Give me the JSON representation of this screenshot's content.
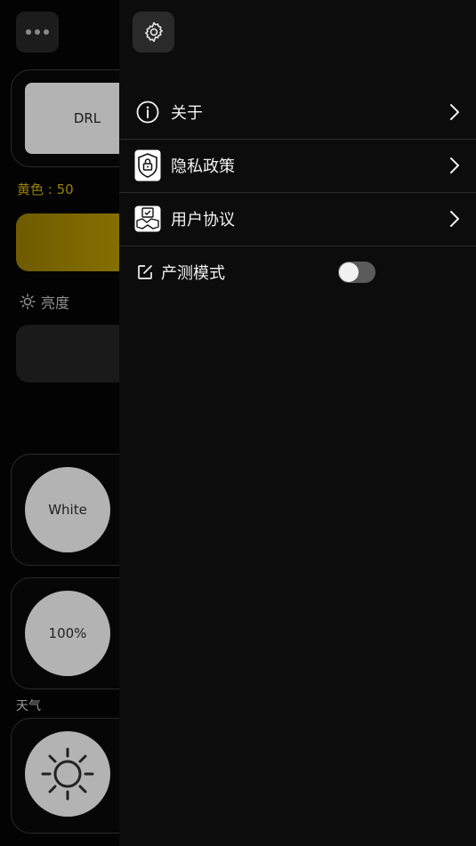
{
  "background": {
    "drl_label": "DRL",
    "yellow_label": "黄色 : 50",
    "brightness_label": "亮度",
    "white_label": "White",
    "percent_label": "100%",
    "weather_label": "天气"
  },
  "drawer": {
    "menu": [
      {
        "label": "关于",
        "icon": "info-icon"
      },
      {
        "label": "隐私政策",
        "icon": "shield-lock-icon"
      },
      {
        "label": "用户协议",
        "icon": "handshake-icon"
      }
    ],
    "production_mode": {
      "label": "产测模式",
      "enabled": false
    }
  }
}
